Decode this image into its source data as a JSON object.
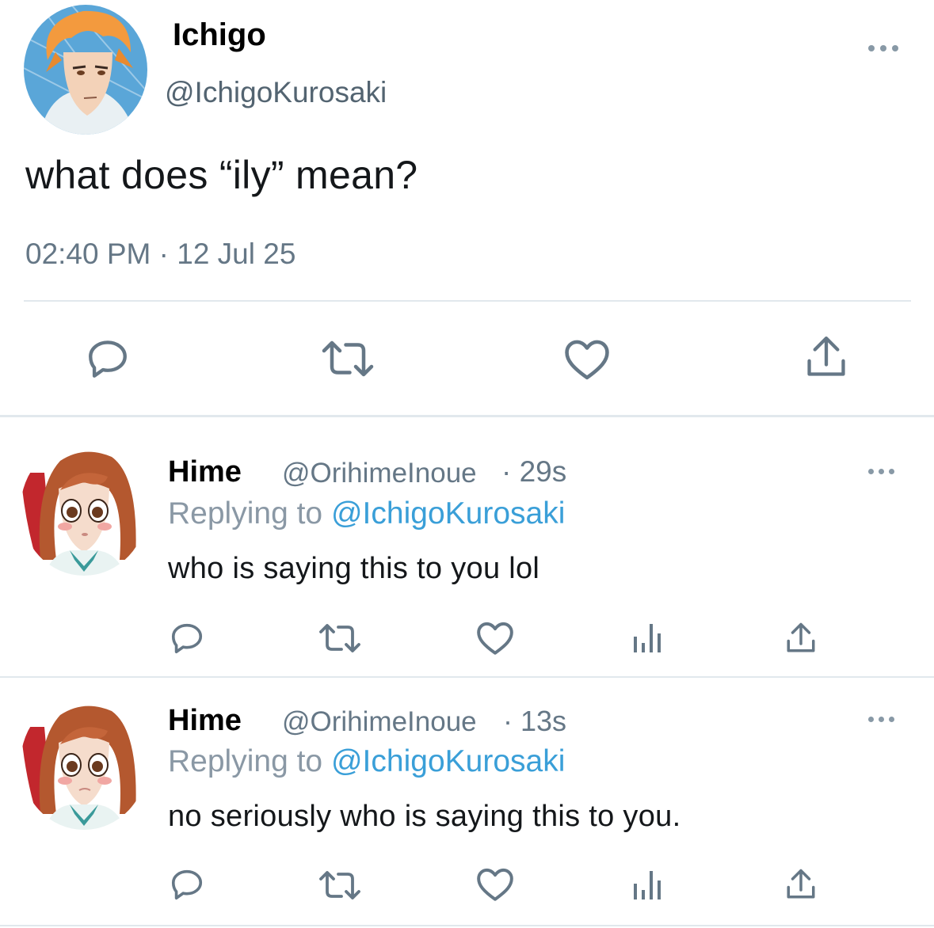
{
  "main_tweet": {
    "display_name": "Ichigo",
    "handle": "@IchigoKurosaki",
    "text": "what does “ily” mean?",
    "timestamp": "02:40 PM · 12 Jul 25",
    "avatar_icon": "ichigo-avatar"
  },
  "replies": [
    {
      "display_name": "Hime",
      "handle": "@OrihimeInoue",
      "separator": "·",
      "time": "29s",
      "replying_label": "Replying to",
      "replying_mention": "@IchigoKurosaki",
      "text": "who is saying this to you lol",
      "avatar_icon": "orihime-avatar"
    },
    {
      "display_name": "Hime",
      "handle": "@OrihimeInoue",
      "separator": "·",
      "time": "13s",
      "replying_label": "Replying to",
      "replying_mention": "@IchigoKurosaki",
      "text": "no seriously who is saying this to you.",
      "avatar_icon": "orihime-avatar"
    }
  ],
  "icons": {
    "reply": "reply-icon",
    "retweet": "retweet-icon",
    "like": "heart-icon",
    "analytics": "analytics-icon",
    "share": "share-icon",
    "more": "more-icon"
  },
  "colors": {
    "icon_gray": "#657786",
    "mention_blue": "#3a9fd8",
    "divider": "#e1e8ed"
  }
}
